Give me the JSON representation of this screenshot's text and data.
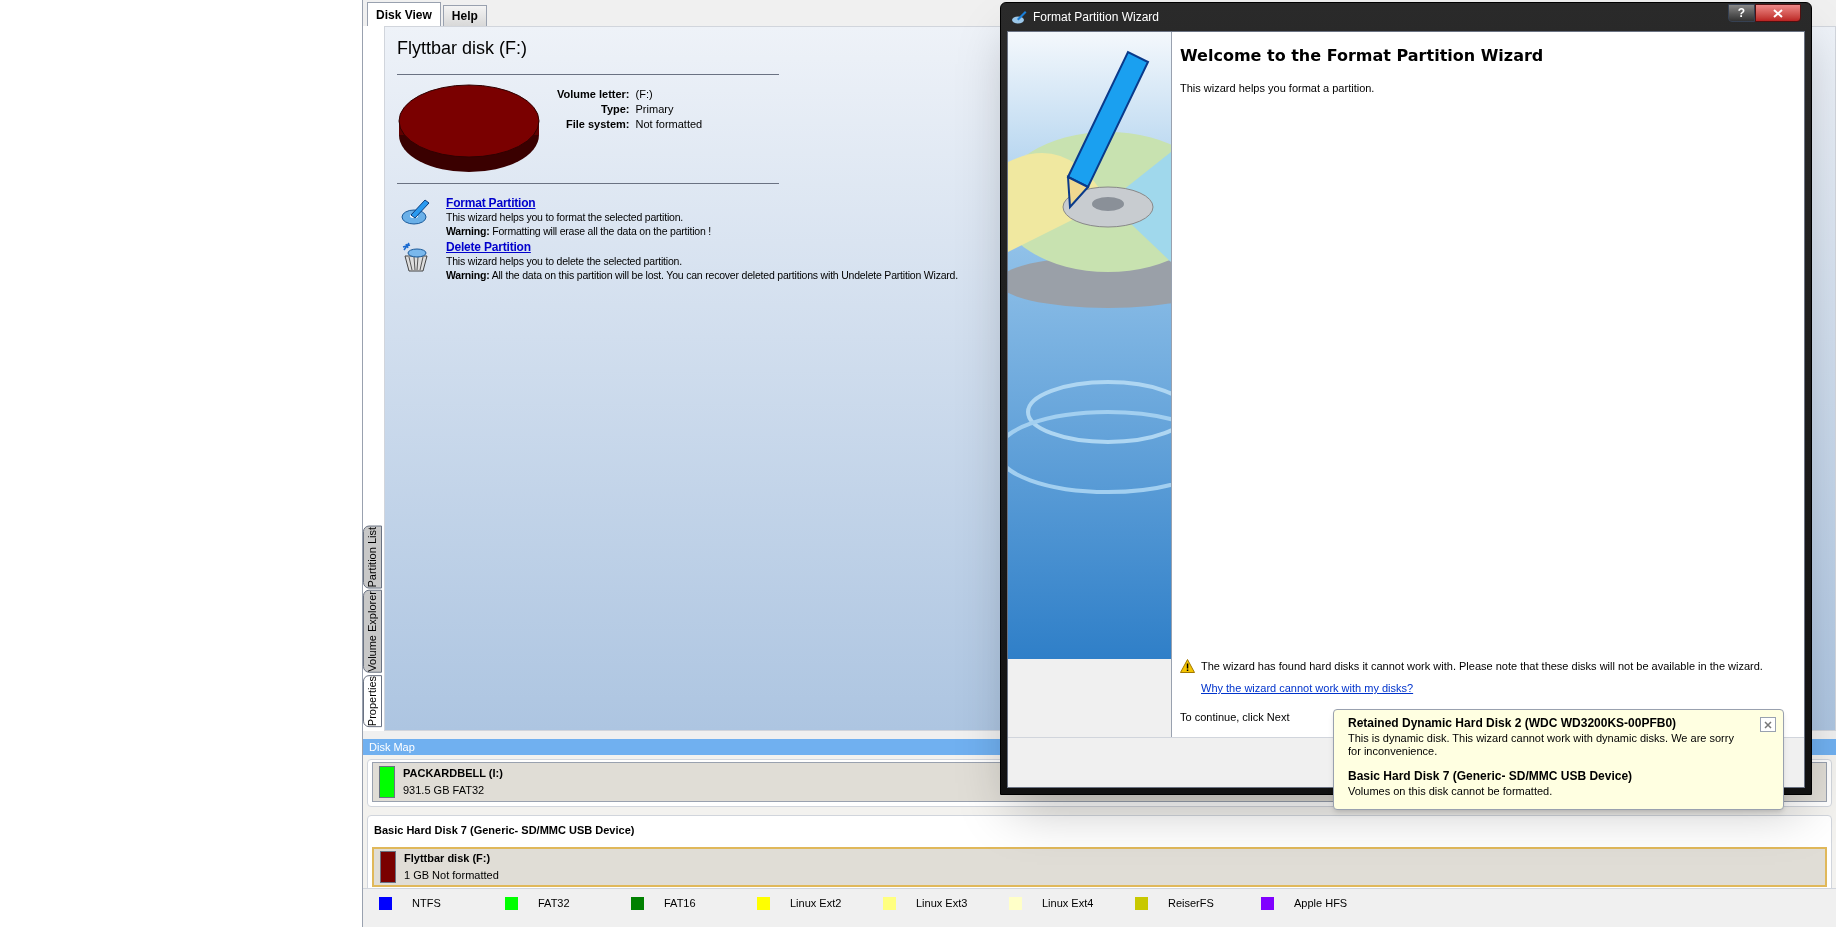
{
  "tabs": [
    {
      "label": "Disk View",
      "selected": true
    },
    {
      "label": "Help",
      "selected": false
    }
  ],
  "side_tabs": [
    {
      "label": "Partition List",
      "selected": false
    },
    {
      "label": "Volume Explorer",
      "selected": false
    },
    {
      "label": "Properties",
      "selected": true
    }
  ],
  "properties": {
    "title": "Flyttbar disk (F:)",
    "color": "#7a0000",
    "fields": [
      {
        "label": "Volume letter:",
        "value": "(F:)"
      },
      {
        "label": "Type:",
        "value": "Primary"
      },
      {
        "label": "File system:",
        "value": "Not formatted"
      }
    ],
    "actions": [
      {
        "kind": "format",
        "link": "Format Partition",
        "description": "This wizard helps you to format the selected partition.",
        "warning": "**Warning:** Formatting will erase all the data on the partition !"
      },
      {
        "kind": "delete",
        "link": "Delete Partition",
        "description": "This wizard helps you to delete the selected partition.",
        "warning": "**Warning:** All the data on this partition will be lost. You can recover deleted partitions with Undelete Partition Wizard."
      }
    ]
  },
  "disk_map": {
    "title": "Disk Map",
    "disks": [
      {
        "partitions": [
          {
            "name": "PACKARDBELL (I:)",
            "info": "931.5 GB FAT32",
            "color": "#00ff00",
            "selected": false
          }
        ]
      },
      {
        "header": "Basic Hard Disk 7 (Generic- SD/MMC USB Device)",
        "partitions": [
          {
            "name": "Flyttbar disk (F:)",
            "info": "1 GB Not formatted",
            "color": "#7a0000",
            "selected": true
          }
        ]
      }
    ]
  },
  "legend": [
    {
      "label": "NTFS",
      "color": "#0000ff"
    },
    {
      "label": "FAT32",
      "color": "#00ff00"
    },
    {
      "label": "FAT16",
      "color": "#008000"
    },
    {
      "label": "Linux Ext2",
      "color": "#ffff00"
    },
    {
      "label": "Linux Ext3",
      "color": "#ffff80"
    },
    {
      "label": "Linux Ext4",
      "color": "#ffffc8"
    },
    {
      "label": "ReiserFS",
      "color": "#c8c800"
    },
    {
      "label": "Apple HFS",
      "color": "#8000ff"
    }
  ],
  "wizard": {
    "title": "Format Partition Wizard",
    "help_button": "?",
    "heading": "Welcome to the Format Partition Wizard",
    "intro": "This wizard helps you format a partition.",
    "warning": "The wizard has found hard disks it cannot work with. Please note that these disks will not be available in the wizard.",
    "link": "Why the wizard cannot work with my disks?",
    "continue": "To continue, click Next"
  },
  "tooltip": {
    "items": [
      {
        "title": "Retained Dynamic Hard Disk 2 (WDC WD3200KS-00PFB0)",
        "text": "This is dynamic disk. This wizard cannot work with dynamic disks. We are sorry for inconvenience."
      },
      {
        "title": "Basic Hard Disk 7 (Generic- SD/MMC USB Device)",
        "text": "Volumes on this disk cannot be formatted."
      }
    ]
  }
}
